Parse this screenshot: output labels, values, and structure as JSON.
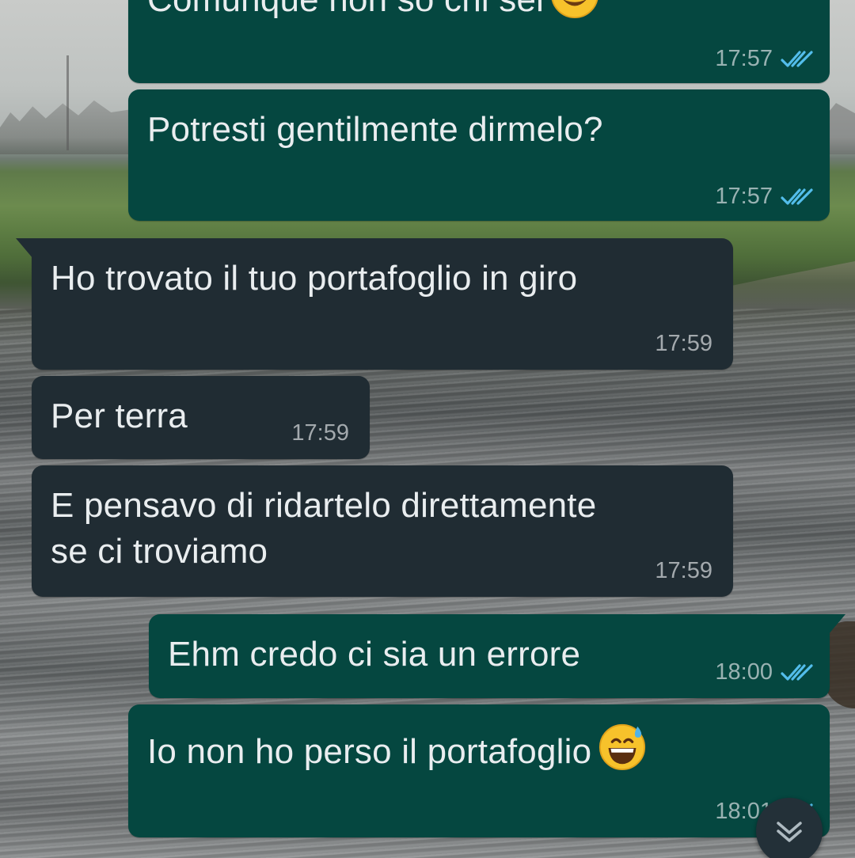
{
  "messages": [
    {
      "id": "m1",
      "direction": "outgoing",
      "text": "Comunque non so chi sei",
      "emoji": "smiling-face-emoji",
      "time": "17:57",
      "status": "read"
    },
    {
      "id": "m2",
      "direction": "outgoing",
      "text": "Potresti gentilmente dirmelo?",
      "time": "17:57",
      "status": "read"
    },
    {
      "id": "m3",
      "direction": "incoming",
      "text": "Ho trovato il tuo portafoglio in giro",
      "time": "17:59"
    },
    {
      "id": "m4",
      "direction": "incoming",
      "text": "Per terra",
      "time": "17:59"
    },
    {
      "id": "m5",
      "direction": "incoming",
      "text_line1": "E pensavo di ridartelo direttamente",
      "text_line2": "se ci troviamo",
      "time": "17:59"
    },
    {
      "id": "m6",
      "direction": "outgoing",
      "text": "Ehm credo ci sia un errore",
      "time": "18:00",
      "status": "read"
    },
    {
      "id": "m7",
      "direction": "outgoing",
      "text": "Io non ho perso il portafoglio",
      "emoji": "grinning-face-with-sweat-emoji",
      "time": "18:01",
      "status": "read"
    }
  ],
  "icons": {
    "read_ticks": "double-check-icon",
    "scroll_down": "chevron-down-icon"
  },
  "colors": {
    "outgoing_bubble": "#054740",
    "incoming_bubble": "#202c33",
    "text": "#e9edef",
    "read_tick": "#53bdeb"
  }
}
